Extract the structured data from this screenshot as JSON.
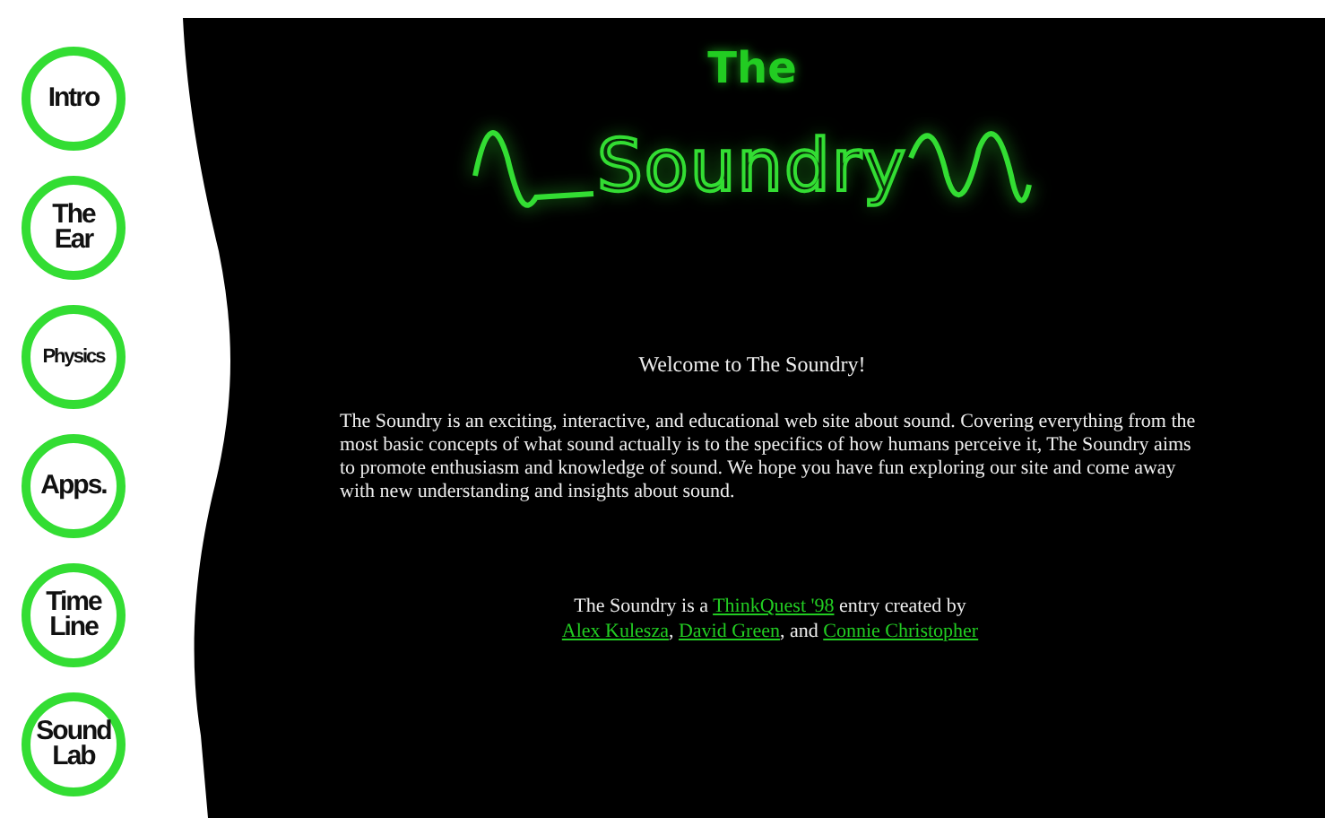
{
  "nav": [
    {
      "lines": [
        "Intro"
      ]
    },
    {
      "lines": [
        "The",
        "Ear"
      ]
    },
    {
      "lines": [
        "Physics"
      ]
    },
    {
      "lines": [
        "Apps."
      ]
    },
    {
      "lines": [
        "Time",
        "Line"
      ]
    },
    {
      "lines": [
        "Sound",
        "Lab"
      ]
    }
  ],
  "logo": {
    "top": "The",
    "main": "Soundry"
  },
  "welcome": "Welcome to The Soundry!",
  "intro": "The Soundry is an exciting, interactive, and educational web site about sound. Covering everything from the most basic concepts of what sound actually is to the specifics of how humans perceive it, The Soundry aims to promote enthusiasm and knowledge of sound. We hope you have fun exploring our site and come away with new understanding and insights about sound.",
  "credits": [
    {
      "kind": "text",
      "text": "The Soundry is a "
    },
    {
      "kind": "link",
      "text": "ThinkQuest '98"
    },
    {
      "kind": "text",
      "text": " entry created by "
    },
    {
      "kind": "break"
    },
    {
      "kind": "link",
      "text": "Alex Kulesza"
    },
    {
      "kind": "text",
      "text": ", "
    },
    {
      "kind": "link",
      "text": "David Green"
    },
    {
      "kind": "text",
      "text": ", and "
    },
    {
      "kind": "link",
      "text": "Connie Christopher"
    }
  ]
}
